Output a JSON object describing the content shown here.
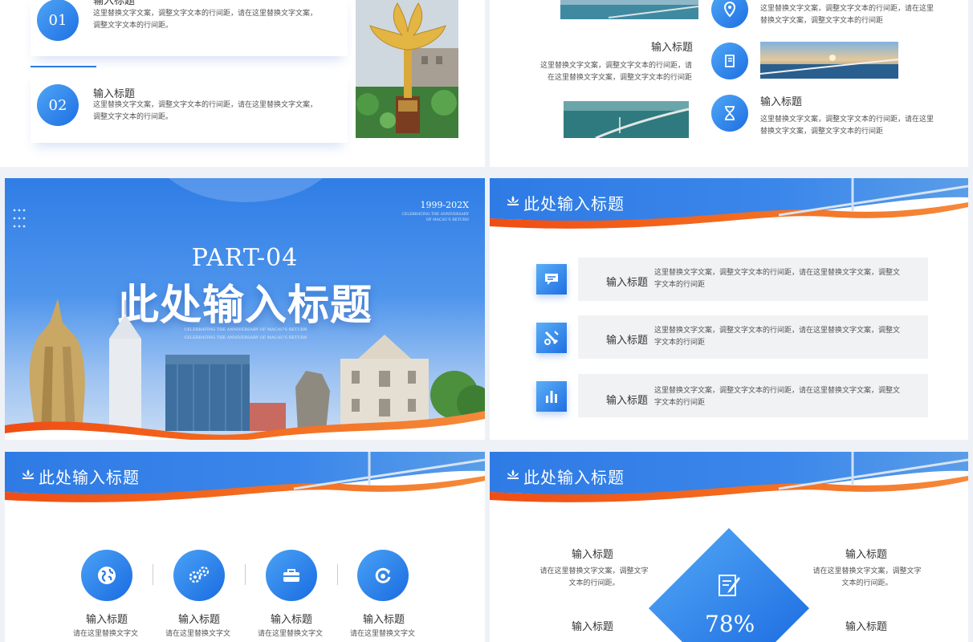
{
  "slide1": {
    "card1": {
      "num": "01",
      "title": "输入标题",
      "text": "这里替换文字文案，调整文字文本的行间距，请在这里替换文字文案，调整文字文本的行间距。"
    },
    "card2": {
      "num": "02",
      "title": "输入标题",
      "text": "这里替换文字文案，调整文字文本的行间距，请在这里替换文字文案，调整文字文本的行间距。"
    }
  },
  "slide2": {
    "left_title": "输入标题",
    "left_text": "这里替换文字文案，调整文字文本的行间距，请在这里替换文字文案，调整文字文本的行间距",
    "top_text": "这里替换文字文案，调整文字文本的行间距，请在这里替换文字文案，调整文字文本的行间距",
    "right_title": "输入标题",
    "right_text": "这里替换文字文案，调整文字文本的行间距，请在这里替换文字文案，调整文字文本的行间距"
  },
  "slide3": {
    "years": "1999-202X",
    "celebrating": "CELEBRATING THE ANNIVERSARY OF MACAU'S RETURN",
    "part": "PART-04",
    "title": "此处输入标题",
    "subtitle": "CELEBRATING THE ANNIVERSARY OF MACAU'S RETURN CELEBRATING THE ANNIVERSARY OF MACAU'S RETURN"
  },
  "slide4": {
    "banner_title": "此处输入标题",
    "rows": [
      {
        "title": "输入标题",
        "text": "这里替换文字文案，调整文字文本的行间距，请在这里替换文字文案，调整文字文本的行间距"
      },
      {
        "title": "输入标题",
        "text": "这里替换文字文案，调整文字文本的行间距，请在这里替换文字文案，调整文字文本的行间距"
      },
      {
        "title": "输入标题",
        "text": "这里替换文字文案，调整文字文本的行间距，请在这里替换文字文案，调整文字文本的行间距"
      }
    ]
  },
  "slide5": {
    "banner_title": "此处输入标题",
    "items": [
      {
        "title": "输入标题",
        "text": "请在这里替换文字文"
      },
      {
        "title": "输入标题",
        "text": "请在这里替换文字文"
      },
      {
        "title": "输入标题",
        "text": "请在这里替换文字文"
      },
      {
        "title": "输入标题",
        "text": "请在这里替换文字文"
      }
    ]
  },
  "slide6": {
    "banner_title": "此处输入标题",
    "tl": {
      "title": "输入标题",
      "text": "请在这里替换文字文案，调整文字文本的行间距。"
    },
    "tr": {
      "title": "输入标题",
      "text": "请在这里替换文字文案，调整文字文本的行间距。"
    },
    "bl": {
      "title": "输入标题"
    },
    "br": {
      "title": "输入标题"
    },
    "percent": "78%"
  },
  "colors": {
    "blue": "#1e6fe3",
    "orange": "#f05a1a"
  }
}
